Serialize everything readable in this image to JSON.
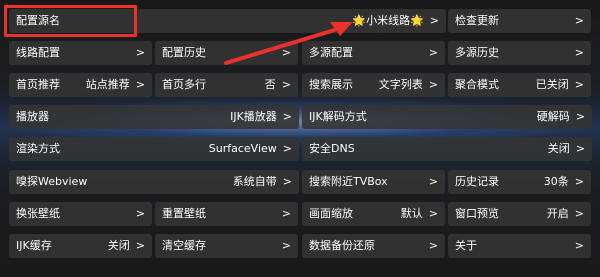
{
  "rows": [
    [
      {
        "name": "config-source-name",
        "label": "配置源名",
        "value": "🌟小米线路🌟",
        "span": 3
      },
      {
        "name": "check-update",
        "label": "检查更新",
        "value": ""
      }
    ],
    [
      {
        "name": "route-config",
        "label": "线路配置",
        "value": ""
      },
      {
        "name": "config-history",
        "label": "配置历史",
        "value": ""
      },
      {
        "name": "multi-source-config",
        "label": "多源配置",
        "value": ""
      },
      {
        "name": "multi-source-history",
        "label": "多源历史",
        "value": ""
      }
    ],
    [
      {
        "name": "home-recommend",
        "label": "首页推荐",
        "value": "站点推荐"
      },
      {
        "name": "home-multi-row",
        "label": "首页多行",
        "value": "否"
      },
      {
        "name": "search-display",
        "label": "搜索展示",
        "value": "文字列表"
      },
      {
        "name": "aggregate-mode",
        "label": "聚合模式",
        "value": "已关闭"
      }
    ],
    [
      {
        "name": "player",
        "label": "播放器",
        "value": "IJK播放器",
        "span": 2
      },
      {
        "name": "ijk-decode-mode",
        "label": "IJK解码方式",
        "value": "硬解码",
        "span": 2
      }
    ],
    [
      {
        "name": "render-mode",
        "label": "渲染方式",
        "value": "SurfaceView",
        "span": 2
      },
      {
        "name": "secure-dns",
        "label": "安全DNS",
        "value": "关闭",
        "span": 2
      }
    ],
    [
      {
        "name": "sniff-webview",
        "label": "嗅探Webview",
        "value": "系统自带",
        "span": 2
      },
      {
        "name": "search-nearby-tvbox",
        "label": "搜索附近TVBox",
        "value": ""
      },
      {
        "name": "history-records",
        "label": "历史记录",
        "value": "30条"
      }
    ],
    [
      {
        "name": "change-wallpaper",
        "label": "换张壁纸",
        "value": ""
      },
      {
        "name": "reset-wallpaper",
        "label": "重置壁纸",
        "value": ""
      },
      {
        "name": "screen-zoom",
        "label": "画面缩放",
        "value": "默认"
      },
      {
        "name": "window-preview",
        "label": "窗口预览",
        "value": "开启"
      }
    ],
    [
      {
        "name": "ijk-cache",
        "label": "IJK缓存",
        "value": "关闭"
      },
      {
        "name": "clear-cache",
        "label": "清空缓存",
        "value": ""
      },
      {
        "name": "data-backup-restore",
        "label": "数据备份还原",
        "value": ""
      },
      {
        "name": "about",
        "label": "关于",
        "value": ""
      }
    ]
  ],
  "chevron": ">",
  "colors": {
    "annotation": "#e8322a",
    "cell_bg": "#343434",
    "text": "#ffffff"
  }
}
